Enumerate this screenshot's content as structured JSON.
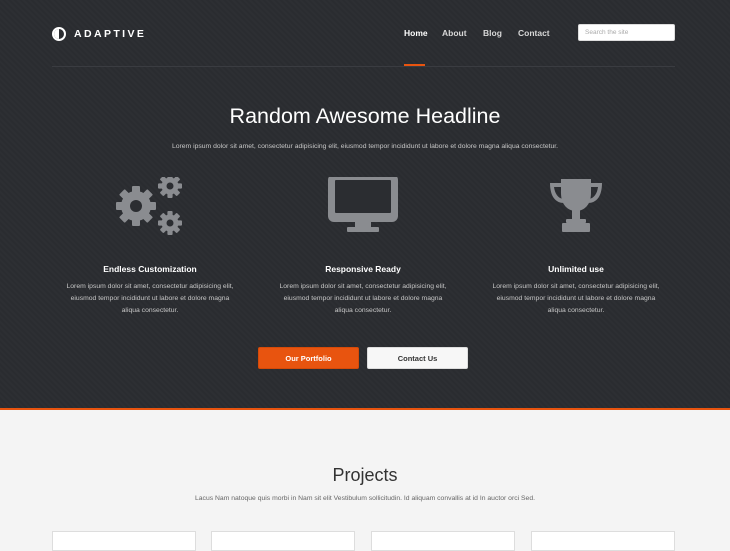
{
  "brand": {
    "name": "ADAPTIVE"
  },
  "nav": {
    "items": [
      "Home",
      "About",
      "Blog",
      "Contact"
    ],
    "active": "Home"
  },
  "search": {
    "placeholder": "Search the site"
  },
  "hero": {
    "headline": "Random Awesome Headline",
    "lead": "Lorem ipsum dolor sit amet, consectetur adipisicing elit, eiusmod tempor incididunt ut labore et dolore magna aliqua consectetur."
  },
  "features": [
    {
      "icon": "gears-icon",
      "title": "Endless Customization",
      "line1": "Lorem ipsum dolor sit amet, consectetur adipisicing elit,",
      "line2": "eiusmod tempor incididunt ut labore et dolore magna",
      "line3": "aliqua consectetur."
    },
    {
      "icon": "monitor-icon",
      "title": "Responsive Ready",
      "line1": "Lorem ipsum dolor sit amet, consectetur adipisicing elit,",
      "line2": "eiusmod tempor incididunt ut labore et dolore magna",
      "line3": "aliqua consectetur."
    },
    {
      "icon": "trophy-icon",
      "title": "Unlimited use",
      "line1": "Lorem ipsum dolor sit amet, consectetur adipisicing elit,",
      "line2": "eiusmod tempor incididunt ut labore et dolore magna",
      "line3": "aliqua consectetur."
    }
  ],
  "buttons": {
    "primary": "Our Portfolio",
    "secondary": "Contact Us"
  },
  "projects": {
    "title": "Projects",
    "subtitle": "Lacus Nam natoque quis morbi in Nam sit elit Vestibulum sollicitudin. Id aliquam convallis at id In auctor orci Sed."
  },
  "colors": {
    "accent": "#e8540f",
    "hero_bg": "#2b2d31",
    "icon_gray": "#8a8c90"
  }
}
